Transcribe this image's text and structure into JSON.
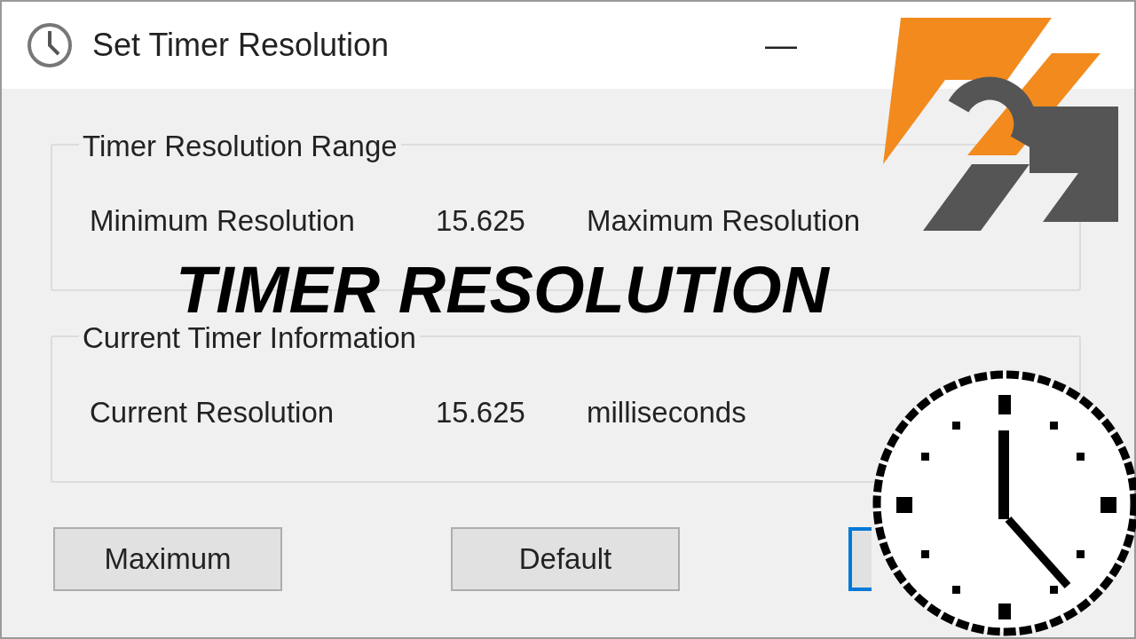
{
  "window": {
    "title": "Set Timer Resolution",
    "minimize": "—"
  },
  "groups": [
    {
      "label": "Timer Resolution Range",
      "cells": [
        "Minimum Resolution",
        "15.625",
        "Maximum Resolution"
      ]
    },
    {
      "label": "Current Timer Information",
      "cells": [
        "Current Resolution",
        "15.625",
        "milliseconds"
      ]
    }
  ],
  "buttons": [
    {
      "label": "Maximum",
      "focused": false
    },
    {
      "label": "Default",
      "focused": false
    },
    {
      "focused": true
    }
  ],
  "overlay": {
    "caption": "TIMER RESOLUTION"
  }
}
